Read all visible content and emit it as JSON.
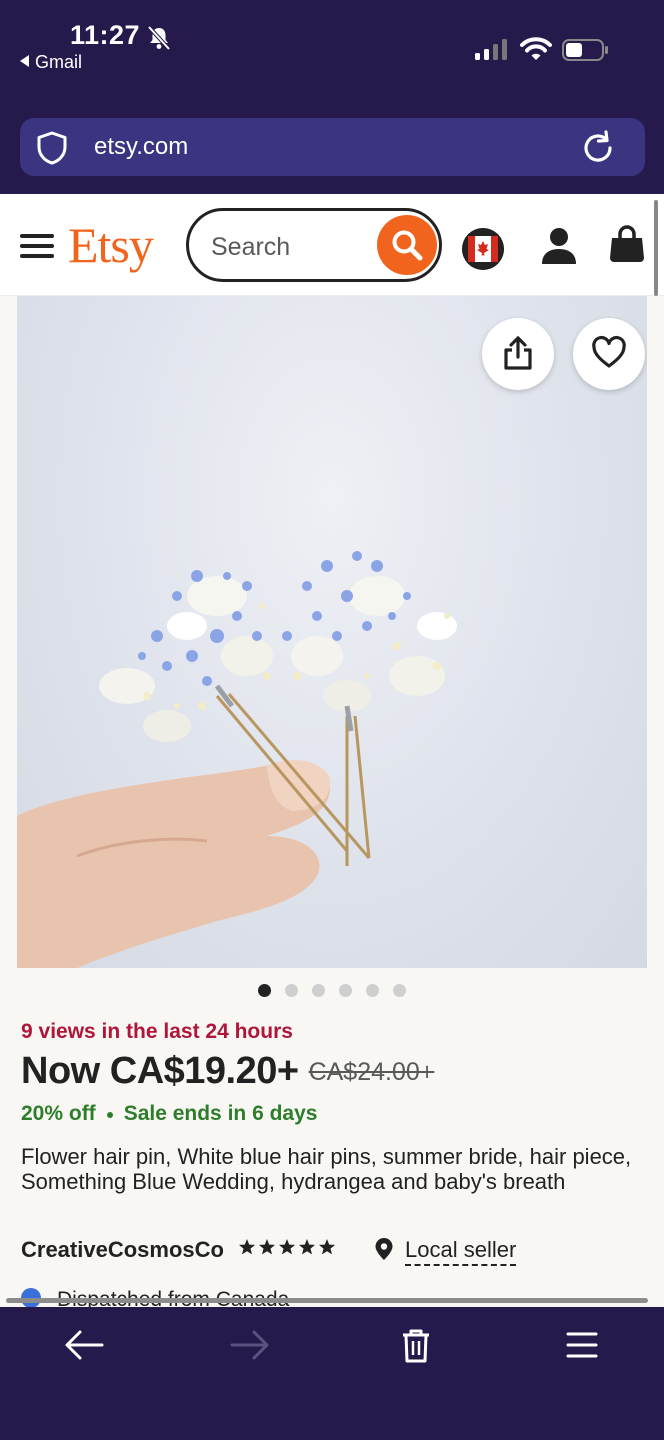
{
  "status_bar": {
    "time": "11:27",
    "back_app": "Gmail"
  },
  "browser": {
    "url": "etsy.com"
  },
  "header": {
    "logo": "Etsy",
    "search_placeholder": "Search"
  },
  "product": {
    "views": "9 views in the last 24 hours",
    "price_now": "Now CA$19.20+",
    "price_original": "CA$24.00+",
    "discount": "20% off",
    "sale_ends": "Sale ends in 6 days",
    "title": "Flower hair pin, White blue hair pins, summer bride, hair piece, Something Blue Wedding, hydrangea and baby's breath",
    "shop_name": "CreativeCosmosCo",
    "rating_stars": 5,
    "local_seller": "Local seller",
    "dispatched": "Dispatched from Canada",
    "image_count": 6,
    "active_image": 1
  },
  "colors": {
    "etsy_orange": "#f1641e",
    "chrome_bg": "#251a4b",
    "url_bar_bg": "#3b3480",
    "views_red": "#b0153a",
    "sale_green": "#2e7d2b"
  },
  "icons": [
    "bell-slash-icon",
    "signal-icon",
    "wifi-icon",
    "battery-icon",
    "shield-icon",
    "reload-icon",
    "hamburger-icon",
    "search-icon",
    "canada-flag-icon",
    "user-icon",
    "bag-icon",
    "share-icon",
    "heart-icon",
    "star-icon",
    "location-pin-icon",
    "back-arrow-icon",
    "forward-arrow-icon",
    "trash-icon",
    "menu-icon"
  ]
}
